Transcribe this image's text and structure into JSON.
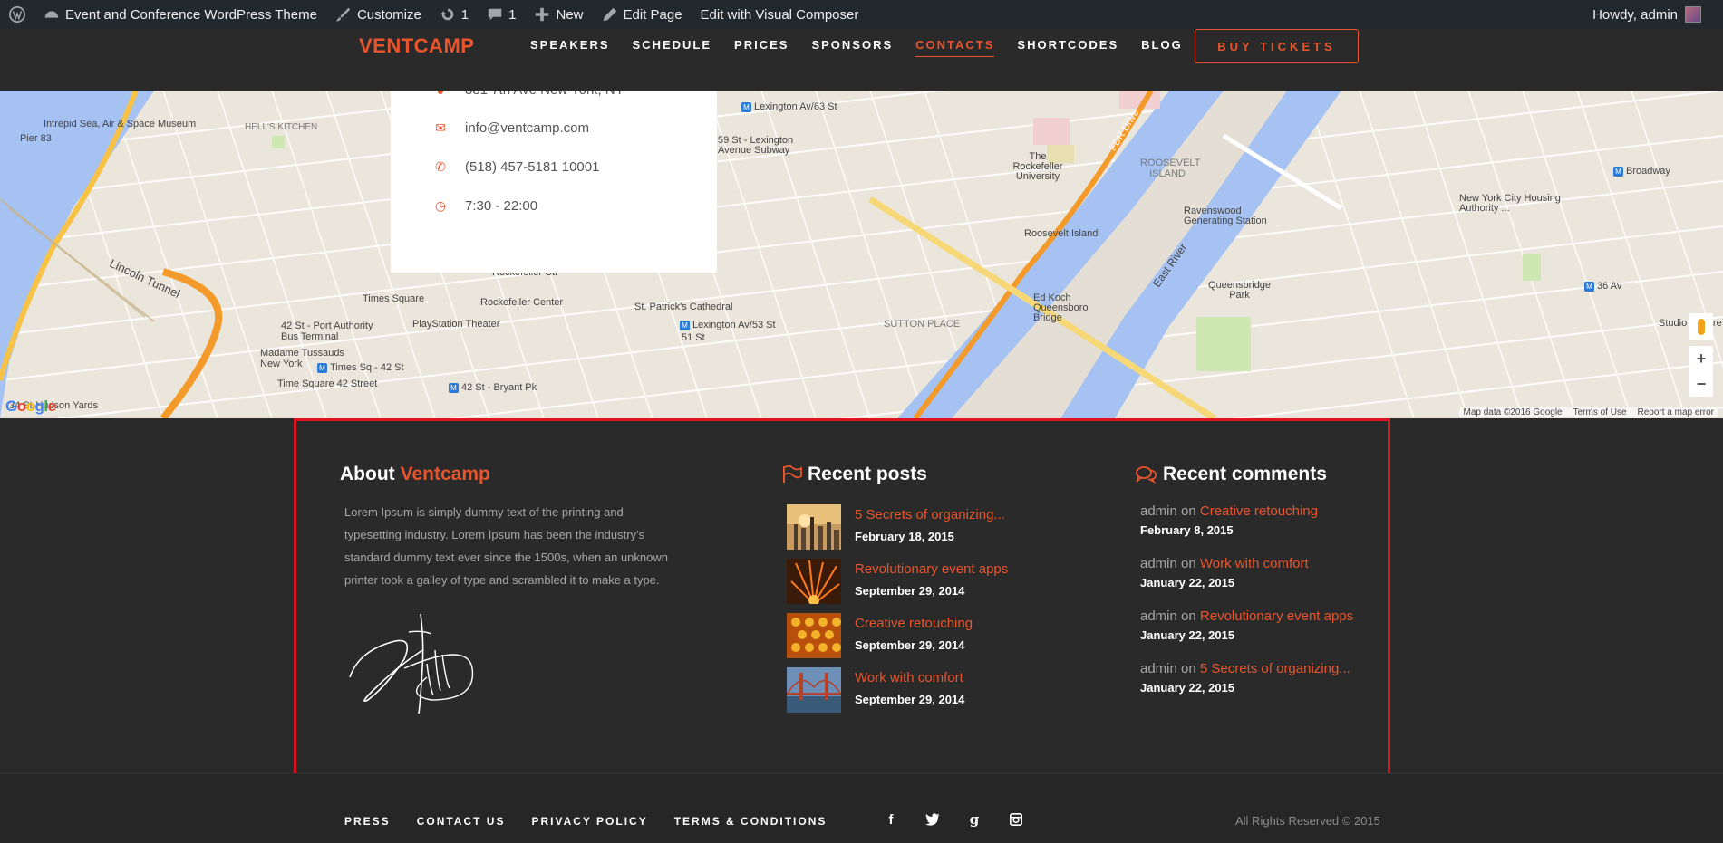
{
  "admin_bar": {
    "site_name": "Event and Conference WordPress Theme",
    "customize": "Customize",
    "updates": "1",
    "comments": "1",
    "new": "New",
    "edit_page": "Edit Page",
    "visual_composer": "Edit with Visual Composer",
    "howdy": "Howdy, admin"
  },
  "header": {
    "logo": "VENTCAMP",
    "nav": [
      "SPEAKERS",
      "SCHEDULE",
      "PRICES",
      "SPONSORS",
      "CONTACTS",
      "SHORTCODES",
      "BLOG"
    ],
    "active_nav": "CONTACTS",
    "buy_tickets": "BUY TICKETS"
  },
  "contact_card": {
    "address": "881 7th Ave New York, NY",
    "email": "info@ventcamp.com",
    "phone": "(518) 457-5181 10001",
    "hours": "7:30 - 22:00"
  },
  "map": {
    "labels": {
      "intrepid": "Intrepid Sea, Air & Space Museum",
      "pier83": "Pier 83",
      "hells_kitchen": "HELL'S KITCHEN",
      "lincoln_tunnel": "Lincoln Tunnel",
      "port_authority": "42 St - Port Authority Bus Terminal",
      "madame": "Madame Tussauds New York",
      "times_sq_42": "Times Sq - 42 St",
      "time_square_42": "Time Square 42 Street",
      "hudson_yards": "34 St-Hudson Yards",
      "times_square": "Times Square",
      "rockefeller_ctr": "Rockefeller Ctr",
      "rockefeller_center": "Rockefeller Center",
      "st_patricks": "St. Patrick's Cathedral",
      "playstation": "PlayStation Theater",
      "bryant": "42 St - Bryant Pk",
      "lexington_63": "Lexington Av/63 St",
      "lexington_59": "59 St - Lexington Avenue Subway",
      "lexington_53": "Lexington Av/53 St",
      "st51": "51 St",
      "sutton_place": "SUTTON PLACE",
      "rockefeller_univ": "The Rockefeller University",
      "roosevelt_island_area": "ROOSEVELT ISLAND",
      "roosevelt_island": "Roosevelt Island",
      "ravenswood": "Ravenswood Generating Station",
      "queensbridge_park": "Queensbridge Park",
      "ed_koch": "Ed Koch Queensboro Bridge",
      "east_river": "East River",
      "broadway": "Broadway",
      "nyc_housing": "New York City Housing Authority ...",
      "studio_square": "Studio Square",
      "av36": "36 Av",
      "fdr": "FDR Drive"
    },
    "attribution": "Map data ©2016 Google",
    "terms": "Terms of Use",
    "report": "Report a map error",
    "google": "Google"
  },
  "about": {
    "title_prefix": "About",
    "title_highlight": "Ventcamp",
    "text": "Lorem Ipsum is simply dummy text of the printing and typesetting industry. Lorem Ipsum has been the industry's standard dummy text ever since the 1500s, when an unknown printer took a galley of type and scrambled it to make a type."
  },
  "recent_posts": {
    "title": "Recent posts",
    "items": [
      {
        "title": "5 Secrets of organizing...",
        "date": "February 18, 2015"
      },
      {
        "title": "Revolutionary event apps",
        "date": "September 29, 2014"
      },
      {
        "title": "Creative retouching",
        "date": "September 29, 2014"
      },
      {
        "title": "Work with comfort",
        "date": "September 29, 2014"
      }
    ]
  },
  "recent_comments": {
    "title": "Recent comments",
    "items": [
      {
        "author": "admin",
        "on": "on",
        "post": "Creative retouching",
        "date": "February 8, 2015"
      },
      {
        "author": "admin",
        "on": "on",
        "post": "Work with comfort",
        "date": "January 22, 2015"
      },
      {
        "author": "admin",
        "on": "on",
        "post": "Revolutionary event apps",
        "date": "January 22, 2015"
      },
      {
        "author": "admin",
        "on": "on",
        "post": "5 Secrets of organizing...",
        "date": "January 22, 2015"
      }
    ]
  },
  "footer": {
    "nav": [
      "PRESS",
      "CONTACT US",
      "PRIVACY POLICY",
      "TERMS & CONDITIONS"
    ],
    "social": [
      "facebook-icon",
      "twitter-icon",
      "google-plus-icon",
      "instagram-icon"
    ],
    "copyright": "All Rights Reserved © 2015"
  },
  "colors": {
    "accent": "#e8552d",
    "dark_bg": "#2a2a2a",
    "admin_bar": "#23282d",
    "highlight_box": "#e0141e"
  }
}
